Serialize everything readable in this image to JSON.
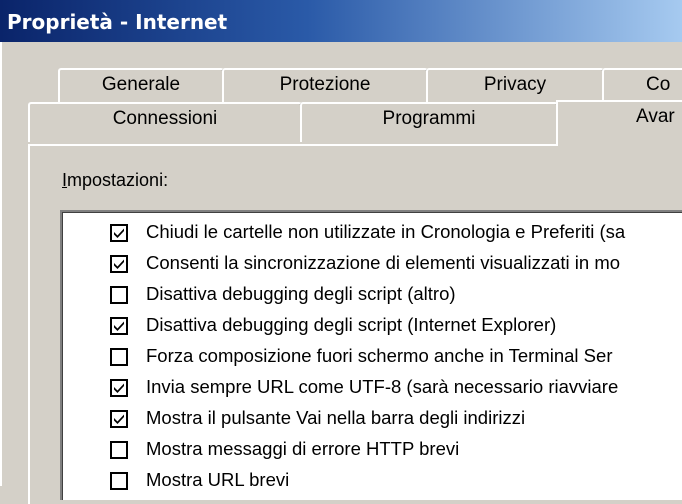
{
  "window": {
    "title": "Proprietà - Internet"
  },
  "tabs_row1": [
    "Generale",
    "Protezione",
    "Privacy",
    "Co"
  ],
  "tabs_row2": [
    "Connessioni",
    "Programmi",
    "Avar"
  ],
  "settings": {
    "label_prefix": "I",
    "label_rest": "mpostazioni:",
    "items": [
      {
        "label": "Chiudi le cartelle non utilizzate in Cronologia e Preferiti (sa",
        "checked": true
      },
      {
        "label": "Consenti la sincronizzazione di elementi visualizzati in mo",
        "checked": true
      },
      {
        "label": "Disattiva debugging degli script (altro)",
        "checked": false
      },
      {
        "label": "Disattiva debugging degli script (Internet Explorer)",
        "checked": true
      },
      {
        "label": "Forza composizione fuori schermo anche in Terminal Ser",
        "checked": false
      },
      {
        "label": "Invia sempre URL come UTF-8 (sarà necessario riavviare",
        "checked": true
      },
      {
        "label": "Mostra il pulsante Vai nella barra degli indirizzi",
        "checked": true
      },
      {
        "label": "Mostra messaggi di errore HTTP brevi",
        "checked": false
      },
      {
        "label": "Mostra URL brevi",
        "checked": false
      }
    ]
  }
}
